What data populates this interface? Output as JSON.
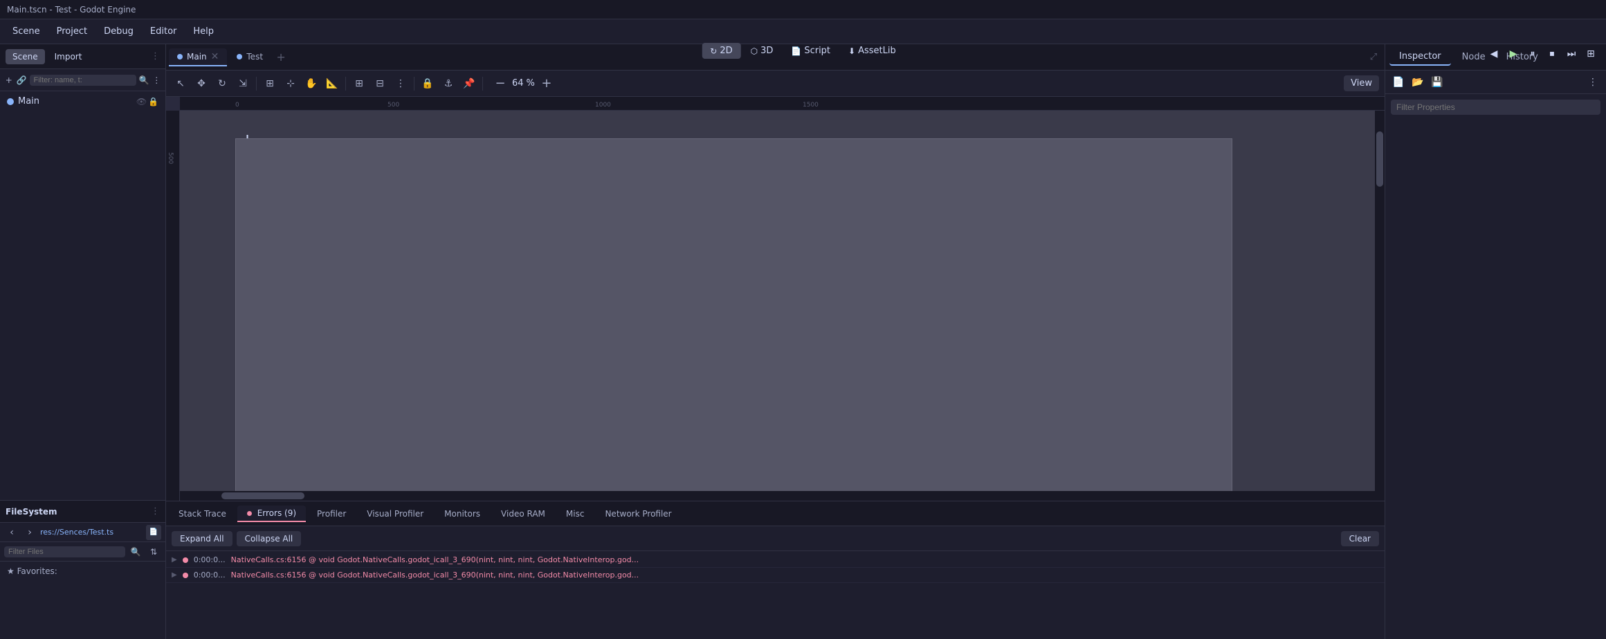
{
  "titlebar": {
    "text": "Main.tscn - Test - Godot Engine"
  },
  "menubar": {
    "items": [
      "Scene",
      "Project",
      "Debug",
      "Editor",
      "Help"
    ]
  },
  "toolbar2d": {
    "buttons": [
      "2D",
      "3D",
      "Script",
      "AssetLib"
    ],
    "active": "2D"
  },
  "playback": {
    "buttons": [
      "◀",
      "▶",
      "⏸",
      "⏹",
      "⏭",
      "⊞"
    ]
  },
  "left_panel": {
    "scene_tab": "Scene",
    "import_tab": "Import",
    "scene_filter_placeholder": "Filter: name, t:",
    "main_node": "Main",
    "filesystem_title": "FileSystem",
    "fs_path": "res://Sences/Test.ts",
    "filter_files_placeholder": "Filter Files",
    "favorites_label": "★ Favorites:"
  },
  "editor_tabs": {
    "tabs": [
      {
        "id": "main",
        "icon": "●",
        "label": "Main",
        "active": true
      },
      {
        "id": "test",
        "icon": "●",
        "label": "Test",
        "active": false
      }
    ],
    "add_label": "+"
  },
  "editor_toolbar": {
    "zoom_value": "64",
    "zoom_unit": "%",
    "view_label": "View"
  },
  "bottom_panel": {
    "tabs": [
      {
        "id": "stack-trace",
        "label": "Stack Trace",
        "active": false,
        "has_dot": false
      },
      {
        "id": "errors",
        "label": "Errors (9)",
        "active": true,
        "has_dot": true
      },
      {
        "id": "profiler",
        "label": "Profiler",
        "active": false,
        "has_dot": false
      },
      {
        "id": "visual-profiler",
        "label": "Visual Profiler",
        "active": false,
        "has_dot": false
      },
      {
        "id": "monitors",
        "label": "Monitors",
        "active": false,
        "has_dot": false
      },
      {
        "id": "video-ram",
        "label": "Video RAM",
        "active": false,
        "has_dot": false
      },
      {
        "id": "misc",
        "label": "Misc",
        "active": false,
        "has_dot": false
      },
      {
        "id": "network-profiler",
        "label": "Network Profiler",
        "active": false,
        "has_dot": false
      }
    ],
    "expand_all_label": "Expand All",
    "collapse_all_label": "Collapse All",
    "clear_label": "Clear",
    "errors": [
      {
        "time": "0:00:0...",
        "message": "NativeCalls.cs:6156 @ void Godot.NativeCalls.godot_icall_3_690(nint, nint, nint, Godot.NativeInterop.god..."
      },
      {
        "time": "0:00:0...",
        "message": "NativeCalls.cs:6156 @ void Godot.NativeCalls.godot_icall_3_690(nint, nint, nint, Godot.NativeInterop.god..."
      }
    ]
  },
  "inspector": {
    "tabs": [
      "Inspector",
      "Node",
      "History"
    ],
    "active_tab": "Inspector",
    "filter_placeholder": "Filter Properties",
    "toolbar_icons": [
      "new-scene",
      "open-scene",
      "save-scene",
      "more-options"
    ]
  },
  "ruler": {
    "ticks": [
      "0",
      "500",
      "1000",
      "1500"
    ]
  }
}
